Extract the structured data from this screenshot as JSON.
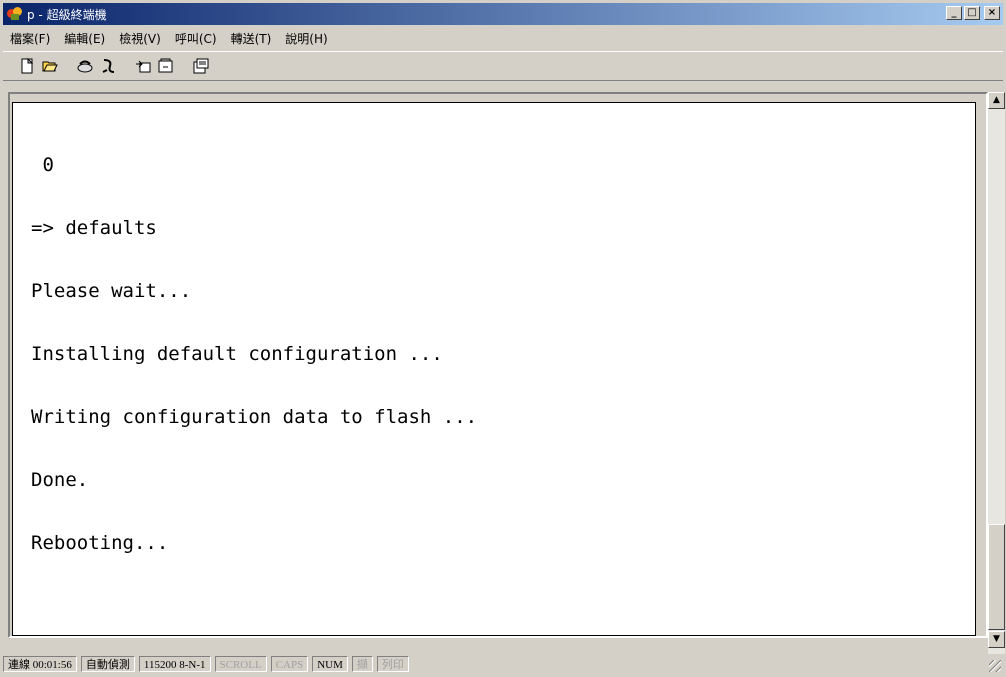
{
  "window": {
    "title": "p - 超級終端機",
    "controls": {
      "minimize": "_",
      "maximize": "□",
      "close": "×"
    }
  },
  "menu": {
    "items": [
      "檔案(F)",
      "編輯(E)",
      "檢視(V)",
      "呼叫(C)",
      "轉送(T)",
      "說明(H)"
    ]
  },
  "toolbar": {
    "buttons": [
      "new-icon",
      "open-icon",
      "connect-icon",
      "disconnect-icon",
      "send-icon",
      "receive-icon",
      "properties-icon"
    ]
  },
  "terminal": {
    "lines": [
      " 0",
      "=> defaults",
      "Please wait...",
      "Installing default configuration ...",
      "Writing configuration data to flash ...",
      "Done.",
      "Rebooting..."
    ]
  },
  "status": {
    "connected": "連線 00:01:56",
    "detect": "自動偵測",
    "settings": "115200 8-N-1",
    "scroll": "SCROLL",
    "caps": "CAPS",
    "num": "NUM",
    "capture": "擷",
    "print": "列印"
  }
}
